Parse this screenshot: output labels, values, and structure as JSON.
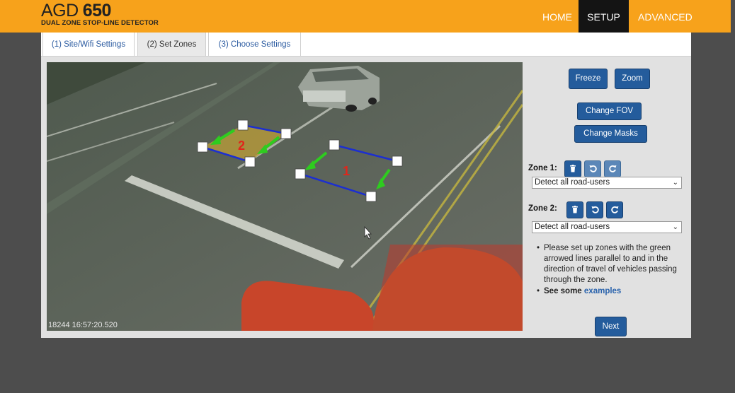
{
  "app": {
    "logo_light": "AGD",
    "logo_bold": "650",
    "subtitle": "DUAL ZONE STOP-LINE DETECTOR"
  },
  "nav": {
    "home": "HOME",
    "setup": "SETUP",
    "advanced": "ADVANCED"
  },
  "tabs": [
    {
      "label": "(1) Site/Wifi Settings"
    },
    {
      "label": "(2) Set Zones"
    },
    {
      "label": "(3) Choose Settings"
    }
  ],
  "camera": {
    "timestamp": "18244  16:57:20.520",
    "zone_labels": [
      "1",
      "2"
    ]
  },
  "controls": {
    "freeze": "Freeze",
    "zoom": "Zoom",
    "change_fov": "Change FOV",
    "change_masks": "Change Masks",
    "next": "Next"
  },
  "zones": [
    {
      "label": "Zone 1:",
      "selected": "Detect all road-users"
    },
    {
      "label": "Zone 2:",
      "selected": "Detect all road-users"
    }
  ],
  "instructions": {
    "text1": "Please set up zones with the green arrowed lines parallel to and in the direction of travel of vehicles passing through the zone.",
    "text2_bold": "See some",
    "text2_link": "examples"
  },
  "colors": {
    "header": "#f7a21b",
    "accent": "#245c9c",
    "zone_line": "#1c2fd0",
    "arrow": "#2ecc1f",
    "zone_number": "#e0261b",
    "mask": "#c0392b"
  },
  "icons": {
    "delete": "trash-icon",
    "undo": "undo-icon",
    "redo": "redo-icon"
  }
}
